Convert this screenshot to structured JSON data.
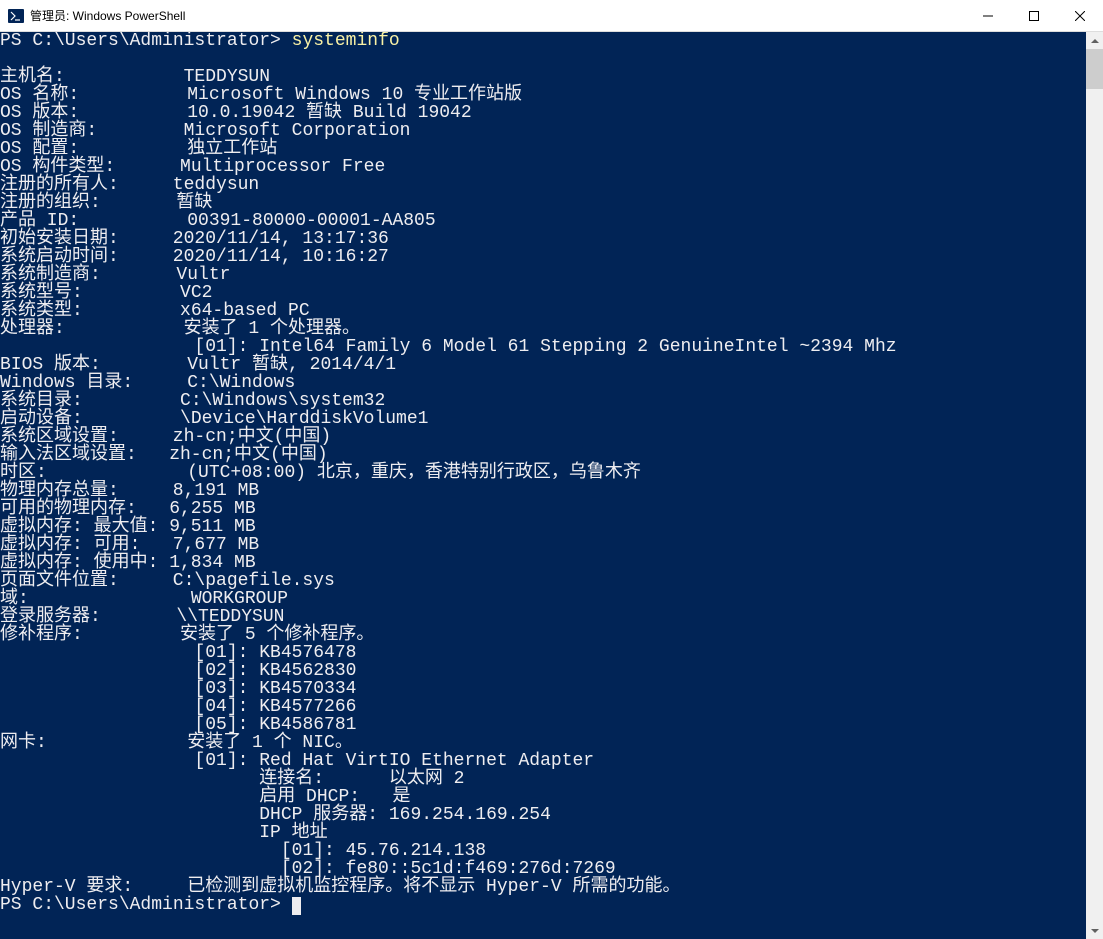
{
  "window": {
    "title": "管理员: Windows PowerShell"
  },
  "prompt": {
    "ps": "PS",
    "path": "C:\\Users\\Administrator",
    "sep": ">",
    "command": "systeminfo"
  },
  "systeminfo": {
    "fields": [
      {
        "label": "主机名:",
        "value": "TEDDYSUN"
      },
      {
        "label": "OS 名称:",
        "value": "Microsoft Windows 10 专业工作站版"
      },
      {
        "label": "OS 版本:",
        "value": "10.0.19042 暂缺 Build 19042"
      },
      {
        "label": "OS 制造商:",
        "value": "Microsoft Corporation"
      },
      {
        "label": "OS 配置:",
        "value": "独立工作站"
      },
      {
        "label": "OS 构件类型:",
        "value": "Multiprocessor Free"
      },
      {
        "label": "注册的所有人:",
        "value": "teddysun"
      },
      {
        "label": "注册的组织:",
        "value": "暂缺"
      },
      {
        "label": "产品 ID:",
        "value": "00391-80000-00001-AA805"
      },
      {
        "label": "初始安装日期:",
        "value": "2020/11/14, 13:17:36"
      },
      {
        "label": "系统启动时间:",
        "value": "2020/11/14, 10:16:27"
      },
      {
        "label": "系统制造商:",
        "value": "Vultr"
      },
      {
        "label": "系统型号:",
        "value": "VC2"
      },
      {
        "label": "系统类型:",
        "value": "x64-based PC"
      },
      {
        "label": "处理器:",
        "value": "安装了 1 个处理器。"
      },
      {
        "label": "",
        "value": "[01]: Intel64 Family 6 Model 61 Stepping 2 GenuineIntel ~2394 Mhz"
      },
      {
        "label": "BIOS 版本:",
        "value": "Vultr 暂缺, 2014/4/1"
      },
      {
        "label": "Windows 目录:",
        "value": "C:\\Windows"
      },
      {
        "label": "系统目录:",
        "value": "C:\\Windows\\system32"
      },
      {
        "label": "启动设备:",
        "value": "\\Device\\HarddiskVolume1"
      },
      {
        "label": "系统区域设置:",
        "value": "zh-cn;中文(中国)"
      },
      {
        "label": "输入法区域设置:",
        "value": "zh-cn;中文(中国)"
      },
      {
        "label": "时区:",
        "value": "(UTC+08:00) 北京，重庆，香港特别行政区，乌鲁木齐"
      },
      {
        "label": "物理内存总量:",
        "value": "8,191 MB"
      },
      {
        "label": "可用的物理内存:",
        "value": "6,255 MB"
      },
      {
        "label": "虚拟内存: 最大值:",
        "value": "9,511 MB"
      },
      {
        "label": "虚拟内存: 可用:",
        "value": "7,677 MB"
      },
      {
        "label": "虚拟内存: 使用中:",
        "value": "1,834 MB"
      },
      {
        "label": "页面文件位置:",
        "value": "C:\\pagefile.sys"
      },
      {
        "label": "域:",
        "value": "WORKGROUP"
      },
      {
        "label": "登录服务器:",
        "value": "\\\\TEDDYSUN"
      },
      {
        "label": "修补程序:",
        "value": "安装了 5 个修补程序。"
      },
      {
        "label": "",
        "value": "[01]: KB4576478"
      },
      {
        "label": "",
        "value": "[02]: KB4562830"
      },
      {
        "label": "",
        "value": "[03]: KB4570334"
      },
      {
        "label": "",
        "value": "[04]: KB4577266"
      },
      {
        "label": "",
        "value": "[05]: KB4586781"
      },
      {
        "label": "网卡:",
        "value": "安装了 1 个 NIC。"
      },
      {
        "label": "",
        "value": "[01]: Red Hat VirtIO Ethernet Adapter"
      },
      {
        "label": "",
        "value": "      连接名:      以太网 2",
        "extraIndent": true
      },
      {
        "label": "",
        "value": "      启用 DHCP:   是",
        "extraIndent": true
      },
      {
        "label": "",
        "value": "      DHCP 服务器: 169.254.169.254",
        "extraIndent": true
      },
      {
        "label": "",
        "value": "      IP 地址",
        "extraIndent": true
      },
      {
        "label": "",
        "value": "        [01]: 45.76.214.138",
        "extraIndent": true
      },
      {
        "label": "",
        "value": "        [02]: fe80::5c1d:f469:276d:7269",
        "extraIndent": true
      },
      {
        "label": "Hyper-V 要求:",
        "value": "已检测到虚拟机监控程序。将不显示 Hyper-V 所需的功能。"
      }
    ]
  }
}
